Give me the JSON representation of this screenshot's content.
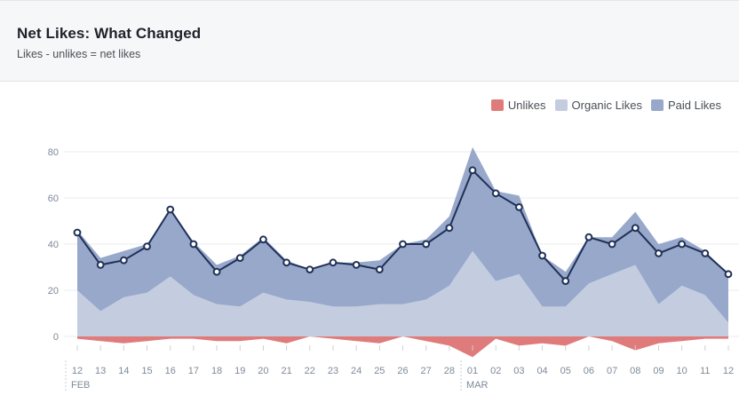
{
  "header": {
    "title": "Net Likes: What Changed",
    "subtitle": "Likes - unlikes = net likes"
  },
  "legend": [
    {
      "label": "Unlikes",
      "color": "#e07b7b"
    },
    {
      "label": "Organic Likes",
      "color": "#c4cde0"
    },
    {
      "label": "Paid Likes",
      "color": "#98a8cb"
    }
  ],
  "chart_data": {
    "type": "area",
    "stacked": true,
    "categories": [
      "12",
      "13",
      "14",
      "15",
      "16",
      "17",
      "18",
      "19",
      "20",
      "21",
      "22",
      "23",
      "24",
      "25",
      "26",
      "27",
      "28",
      "01",
      "02",
      "03",
      "04",
      "05",
      "06",
      "07",
      "08",
      "09",
      "10",
      "11",
      "12"
    ],
    "month_labels": [
      {
        "label": "FEB",
        "index": 0
      },
      {
        "label": "MAR",
        "index": 17
      }
    ],
    "series": [
      {
        "name": "Unlikes",
        "color": "#e07b7b",
        "values": [
          -1,
          -2,
          -3,
          -2,
          -1,
          -1,
          -2,
          -2,
          -1,
          -3,
          0,
          -1,
          -2,
          -3,
          0,
          -2,
          -4,
          -9,
          -1,
          -4,
          -3,
          -4,
          0,
          -2,
          -6,
          -3,
          -2,
          -1,
          -1
        ]
      },
      {
        "name": "Organic Likes",
        "color": "#c4cde0",
        "values": [
          20,
          11,
          17,
          19,
          26,
          18,
          14,
          13,
          19,
          16,
          15,
          13,
          13,
          14,
          14,
          16,
          22,
          37,
          24,
          27,
          13,
          13,
          23,
          27,
          31,
          14,
          22,
          18,
          6
        ]
      },
      {
        "name": "Paid Likes",
        "color": "#98a8cb",
        "values": [
          26,
          23,
          20,
          21,
          29,
          23,
          17,
          22,
          24,
          17,
          14,
          19,
          19,
          19,
          26,
          26,
          30,
          45,
          39,
          34,
          22,
          15,
          20,
          16,
          23,
          26,
          21,
          19,
          21
        ]
      },
      {
        "name": "Net Likes",
        "color": "#1f3157",
        "type": "line",
        "values": [
          45,
          31,
          33,
          39,
          55,
          40,
          28,
          34,
          42,
          32,
          29,
          32,
          31,
          29,
          40,
          40,
          47,
          72,
          62,
          56,
          35,
          24,
          43,
          40,
          47,
          36,
          40,
          36,
          27
        ]
      }
    ],
    "yticks": [
      0,
      20,
      40,
      60,
      80
    ],
    "ylim": [
      -12,
      90
    ],
    "grid": true,
    "legend_position": "top-right"
  }
}
